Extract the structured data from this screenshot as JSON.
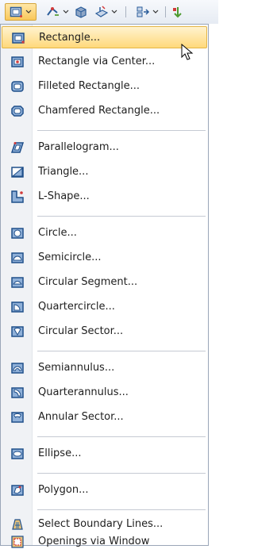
{
  "toolbar": {
    "buttons": [
      {
        "icon": "rectangle-tool-icon",
        "has_dropdown": true,
        "active": true
      },
      {
        "icon": "lines-tool-icon",
        "has_dropdown": true,
        "active": false
      },
      {
        "icon": "solid-tool-icon",
        "has_dropdown": false,
        "active": false
      },
      {
        "icon": "surface-tool-icon",
        "has_dropdown": true,
        "active": false
      },
      {
        "icon": "arrange-tool-icon",
        "has_dropdown": true,
        "active": false
      },
      {
        "icon": "green-arrow-tool-icon",
        "has_dropdown": false,
        "active": false
      }
    ]
  },
  "menu": {
    "items": [
      {
        "label": "Rectangle...",
        "icon": "rectangle-icon"
      },
      {
        "label": "Rectangle via Center...",
        "icon": "rectangle-via-center-icon"
      },
      {
        "label": "Filleted Rectangle...",
        "icon": "filleted-rectangle-icon"
      },
      {
        "label": "Chamfered Rectangle...",
        "icon": "chamfered-rectangle-icon"
      },
      {
        "label": "Parallelogram...",
        "icon": "parallelogram-icon"
      },
      {
        "label": "Triangle...",
        "icon": "triangle-icon"
      },
      {
        "label": "L-Shape...",
        "icon": "l-shape-icon"
      },
      {
        "label": "Circle...",
        "icon": "circle-icon"
      },
      {
        "label": "Semicircle...",
        "icon": "semicircle-icon"
      },
      {
        "label": "Circular Segment...",
        "icon": "circular-segment-icon"
      },
      {
        "label": "Quartercircle...",
        "icon": "quartercircle-icon"
      },
      {
        "label": "Circular Sector...",
        "icon": "circular-sector-icon"
      },
      {
        "label": "Semiannulus...",
        "icon": "semiannulus-icon"
      },
      {
        "label": "Quarterannulus...",
        "icon": "quarterannulus-icon"
      },
      {
        "label": "Annular Sector...",
        "icon": "annular-sector-icon"
      },
      {
        "label": "Ellipse...",
        "icon": "ellipse-icon"
      },
      {
        "label": "Polygon...",
        "icon": "polygon-icon"
      },
      {
        "label": "Select Boundary Lines...",
        "icon": "select-boundary-lines-icon"
      },
      {
        "label": "Openings via Window",
        "icon": "openings-via-window-icon"
      }
    ],
    "highlighted_item": "Rectangle..."
  },
  "colors": {
    "icon_frame": "#2b5d9a",
    "icon_fill": "#c8d6ea",
    "accent_red": "#d23a3a",
    "hover_top": "#fff3cf",
    "hover_bottom": "#ffd97b"
  }
}
